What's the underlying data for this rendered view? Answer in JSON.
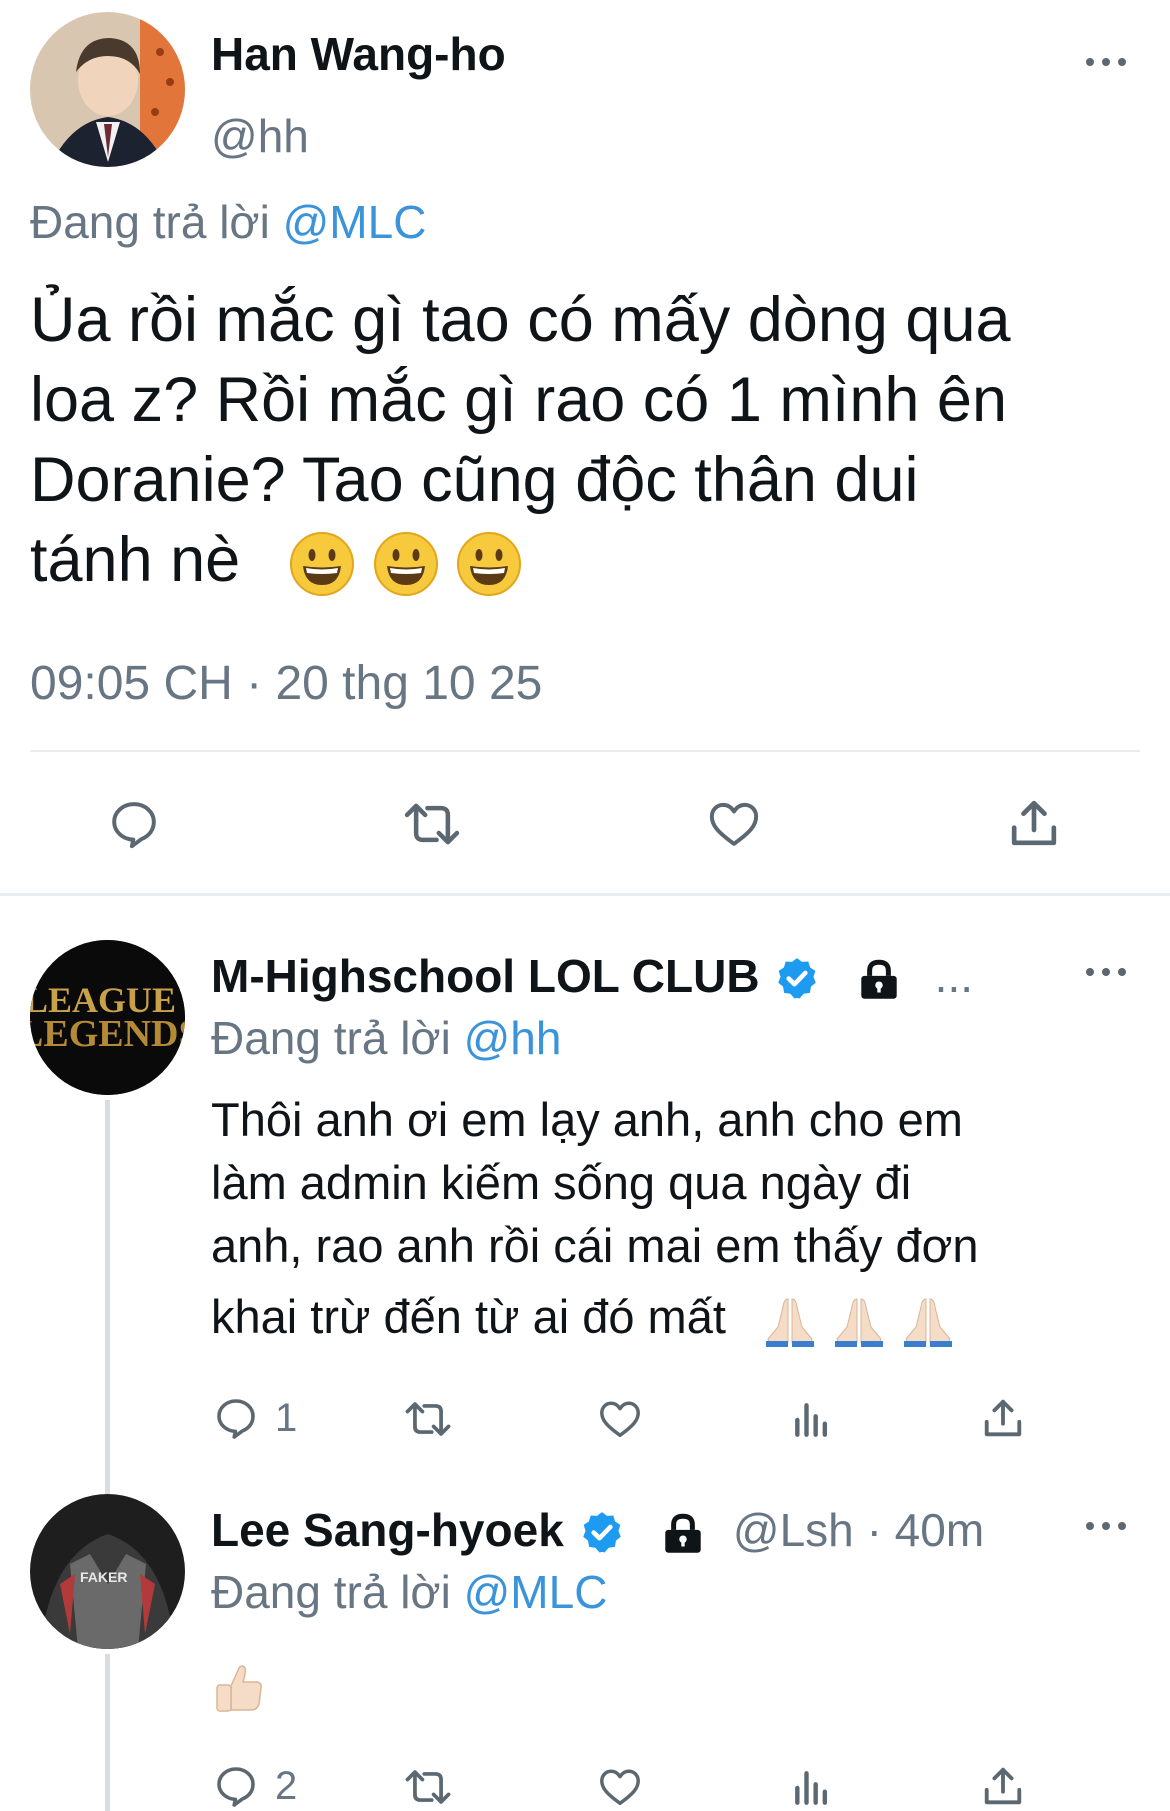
{
  "main_tweet": {
    "author_name": "Han Wang-ho",
    "author_handle": "@hh",
    "replying_prefix": "Đang trả lời",
    "replying_to": "@MLC",
    "body_line1": "Ủa rồi mắc gì tao có mấy dòng qua",
    "body_line2": "loa z? Rồi mắc gì rao có 1 mình ên",
    "body_line3": "Doranie? Tao cũng độc thân dui",
    "body_line4": "tánh nè",
    "body_emojis": [
      "grinning-face-emoji",
      "grinning-face-emoji",
      "grinning-face-emoji"
    ],
    "timestamp": "09:05 CH · 20 thg 10 25",
    "actions": [
      "reply-icon",
      "retweet-icon",
      "like-icon",
      "share-icon"
    ]
  },
  "replies": [
    {
      "author_name": "M-Highschool LOL CLUB",
      "badges": [
        "verified-badge-icon",
        "lock-icon"
      ],
      "truncated": "...",
      "replying_prefix": "Đang trả lời",
      "replying_to": "@hh",
      "body_line1": "Thôi anh ơi em lạy anh, anh cho em",
      "body_line2": "làm admin kiếm sống qua ngày đi",
      "body_line3": "anh, rao anh rồi cái mai em thấy đơn",
      "body_line4": "khai trừ đến từ ai đó mất",
      "body_emojis": [
        "folded-hands-emoji",
        "folded-hands-emoji",
        "folded-hands-emoji"
      ],
      "reply_count": "1",
      "actions": [
        "reply-icon",
        "retweet-icon",
        "like-icon",
        "analytics-icon",
        "share-icon"
      ]
    },
    {
      "author_name": "Lee Sang-hyoek",
      "badges": [
        "verified-badge-icon",
        "lock-icon"
      ],
      "author_handle": "@Lsh",
      "time_sep": "·",
      "time": "40m",
      "replying_prefix": "Đang trả lời",
      "replying_to": "@MLC",
      "body_emojis": [
        "thumbs-up-emoji"
      ],
      "reply_count": "2",
      "actions": [
        "reply-icon",
        "retweet-icon",
        "like-icon",
        "analytics-icon",
        "share-icon"
      ]
    }
  ],
  "colors": {
    "link_blue": "#3b94d9",
    "secondary_gray": "#687684",
    "icon_gray": "#5b6771",
    "divider": "#e6ecf0",
    "verified_blue": "#1d9bf0"
  }
}
